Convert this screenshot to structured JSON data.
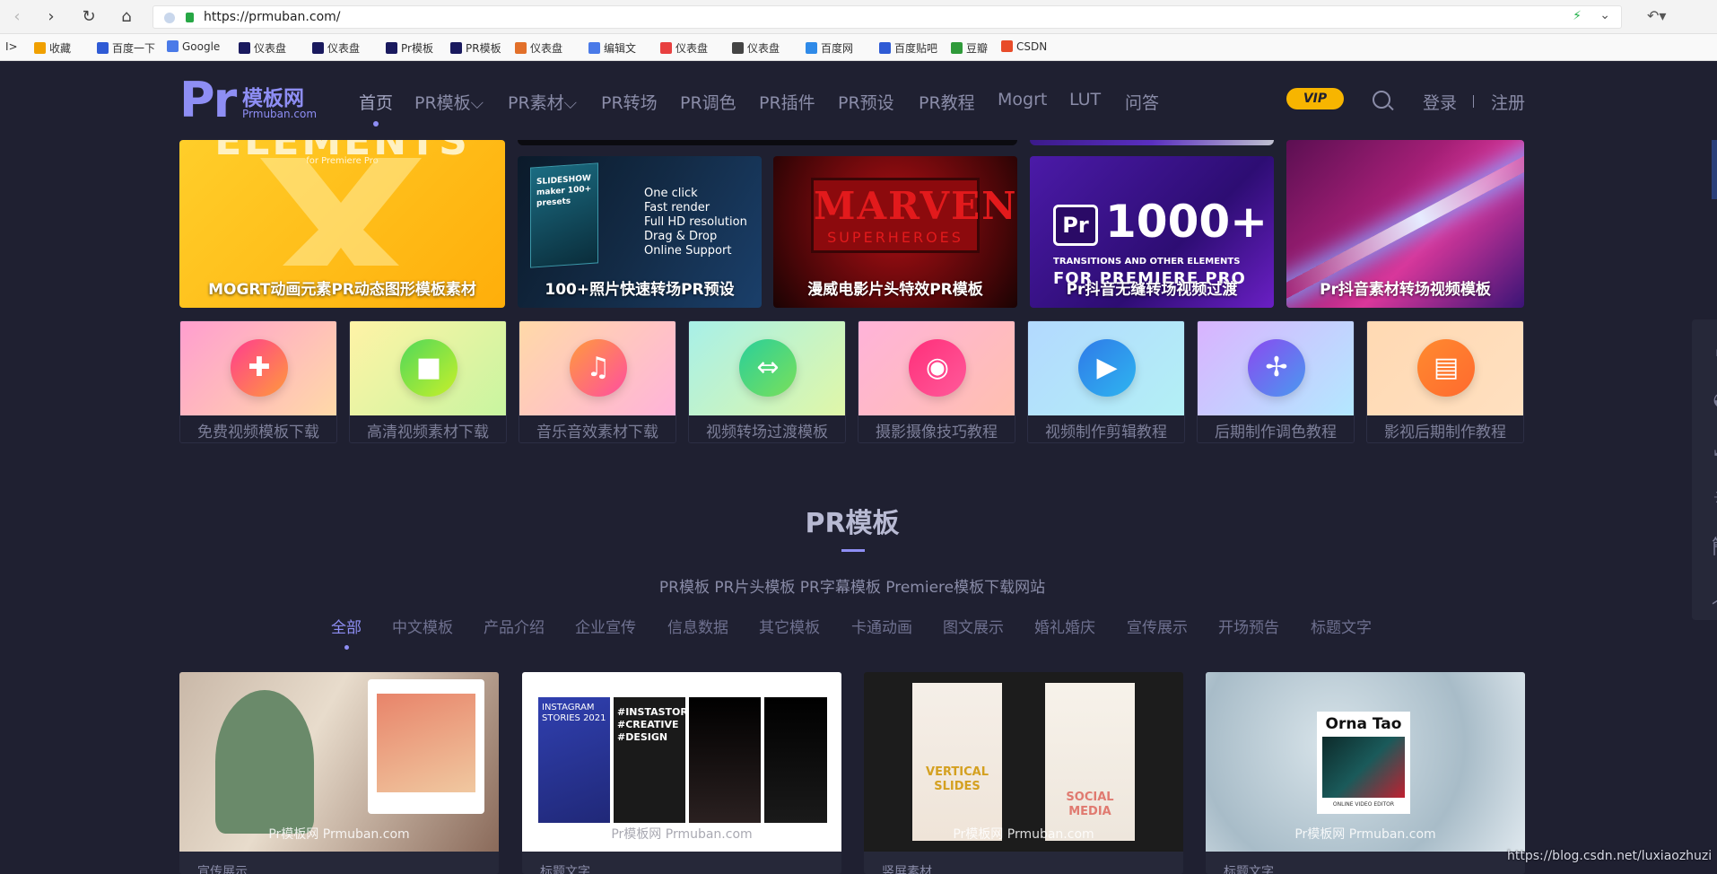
{
  "browser": {
    "url": "https://prmuban.com/",
    "bookmarks_toggle": "I>",
    "bookmarks": [
      {
        "label": "收藏",
        "icon": "star-icon",
        "color": "#f0a000"
      },
      {
        "label": "百度一下",
        "icon": "baidu-icon",
        "color": "#2f5bd5"
      },
      {
        "label": "Google",
        "icon": "google-icon",
        "color": "#4a7ae8"
      },
      {
        "label": "仪表盘",
        "icon": "pr-icon",
        "color": "#1a1a5e"
      },
      {
        "label": "仪表盘",
        "icon": "ae-icon",
        "color": "#1a1a5e"
      },
      {
        "label": "Pr模板",
        "icon": "pr-icon",
        "color": "#1a1a5e"
      },
      {
        "label": "PR模板",
        "icon": "pr-icon",
        "color": "#1a1a5e"
      },
      {
        "label": "仪表盘",
        "icon": "colorful-icon",
        "color": "#e2702a"
      },
      {
        "label": "编辑文",
        "icon": "edit-icon",
        "color": "#4a7ae8"
      },
      {
        "label": "仪表盘",
        "icon": "pr-red-icon",
        "color": "#e84040"
      },
      {
        "label": "仪表盘",
        "icon": "davinci-icon",
        "color": "#444444"
      },
      {
        "label": "百度网",
        "icon": "baidu-pan-icon",
        "color": "#2f8ae8"
      },
      {
        "label": "百度贴吧",
        "icon": "tieba-icon",
        "color": "#2f5bd5"
      },
      {
        "label": "豆瓣",
        "icon": "douban-icon",
        "color": "#2f9a3a"
      },
      {
        "label": "CSDN",
        "icon": "csdn-icon",
        "color": "#e84c2a"
      }
    ]
  },
  "header": {
    "logo_pr": "Pr",
    "logo_cn": "模板网",
    "logo_en": "Prmuban.com",
    "nav": [
      {
        "label": "首页",
        "active": true
      },
      {
        "label": "PR模板⌵"
      },
      {
        "label": "PR素材⌵"
      },
      {
        "label": "PR转场"
      },
      {
        "label": "PR调色"
      },
      {
        "label": "PR插件"
      },
      {
        "label": "PR预设"
      },
      {
        "label": "PR教程"
      },
      {
        "label": "Mogrt"
      },
      {
        "label": "LUT"
      },
      {
        "label": "问答"
      }
    ],
    "vip": "VIP",
    "login": "登录",
    "register": "注册"
  },
  "banners": [
    {
      "caption": "MOGRT动画元素PR动态图形模板素材",
      "top_text": "ELEMENTS",
      "sub_text": "for Premiere Pro"
    },
    {
      "caption": "100+照片快速转场PR预设",
      "box_text": "SLIDESHOW maker 100+ presets",
      "list": "One click\nFast render\nFull HD resolution\nDrag & Drop\nOnline Support"
    },
    {
      "caption": "漫威电影片头特效PR模板",
      "title": "MARVEN",
      "subtitle": "SUPERHEROES"
    },
    {
      "caption": "Pr抖音无缝转场视频过渡",
      "badge": "Pr",
      "number": "1000+",
      "line1": "TRANSITIONS AND OTHER ELEMENTS",
      "line2": "FOR PREMIERE PRO"
    },
    {
      "caption": "Pr抖音素材转场视频模板"
    }
  ],
  "categories": [
    {
      "label": "免费视频模板下载",
      "icon": "puzzle-icon",
      "glyph": "✚",
      "bg": "linear-gradient(135deg,#ff9ecf,#ffd9a8)",
      "circle": "linear-gradient(135deg,#ff3d8e,#ff9a3d)"
    },
    {
      "label": "高清视频素材下载",
      "icon": "video-camera-icon",
      "glyph": "■",
      "bg": "linear-gradient(135deg,#fff3a6,#c8f5a0)",
      "circle": "linear-gradient(135deg,#4fd85a,#c8f02a)"
    },
    {
      "label": "音乐音效素材下载",
      "icon": "music-note-icon",
      "glyph": "♫",
      "bg": "linear-gradient(135deg,#ffd9a8,#ffb3d9)",
      "circle": "linear-gradient(135deg,#ff9a3d,#ff4fa0)"
    },
    {
      "label": "视频转场过渡模板",
      "icon": "transition-icon",
      "glyph": "⇔",
      "bg": "linear-gradient(135deg,#a8f0e8,#e0f7a8)",
      "circle": "linear-gradient(135deg,#2acf9a,#7ae05a)"
    },
    {
      "label": "摄影摄像技巧教程",
      "icon": "camera-icon",
      "glyph": "◉",
      "bg": "linear-gradient(135deg,#ffb3d9,#ffc0b0)",
      "circle": "linear-gradient(135deg,#ff2f7a,#ff5a9a)"
    },
    {
      "label": "视频制作剪辑教程",
      "icon": "film-icon",
      "glyph": "▶",
      "bg": "linear-gradient(135deg,#b3d9ff,#b3f0f5)",
      "circle": "linear-gradient(135deg,#2f7ae8,#2fb5f0)"
    },
    {
      "label": "后期制作调色教程",
      "icon": "aperture-icon",
      "glyph": "✢",
      "bg": "linear-gradient(135deg,#d9b3ff,#b3e8ff)",
      "circle": "linear-gradient(135deg,#8a4af0,#4a9af0)"
    },
    {
      "label": "影视后期制作教程",
      "icon": "news-icon",
      "glyph": "▤",
      "bg": "linear-gradient(135deg,#ffd9b3,#ffe0c0)",
      "circle": "linear-gradient(135deg,#ff8a2f,#ff6a2f)"
    }
  ],
  "section": {
    "title": "PR模板",
    "subtitle": "PR模板 PR片头模板 PR字幕模板 Premiere模板下载网站",
    "filters": [
      {
        "label": "全部",
        "active": true
      },
      {
        "label": "中文模板"
      },
      {
        "label": "产品介绍"
      },
      {
        "label": "企业宣传"
      },
      {
        "label": "信息数据"
      },
      {
        "label": "其它模板"
      },
      {
        "label": "卡通动画"
      },
      {
        "label": "图文展示"
      },
      {
        "label": "婚礼婚庆"
      },
      {
        "label": "宣传展示"
      },
      {
        "label": "开场预告"
      },
      {
        "label": "标题文字"
      }
    ]
  },
  "cards": [
    {
      "watermark": "Pr模板网 Prmuban.com",
      "title": "宣传展示"
    },
    {
      "watermark": "Pr模板网 Prmuban.com",
      "title": "标题文字",
      "texts": [
        "INSTAGRAM STORIES 2021",
        "#INSTASTORY #CREATIVE #DESIGN"
      ]
    },
    {
      "watermark": "Pr模板网 Prmuban.com",
      "title": "竖屏素材",
      "texts": [
        "VERTICAL SLIDES",
        "SOCIAL MEDIA"
      ]
    },
    {
      "watermark": "Pr模板网 Prmuban.com",
      "title": "标题文字",
      "texts": [
        "Orna Tao",
        "ONLINE VIDEO EDITOR"
      ]
    }
  ],
  "side_tools": [
    {
      "icon": "basket-icon",
      "glyph": "⌂"
    },
    {
      "icon": "qq-icon",
      "glyph": "◒"
    },
    {
      "icon": "fullscreen-icon",
      "glyph": "⤢"
    },
    {
      "icon": "brightness-icon",
      "glyph": "☀"
    },
    {
      "icon": "simplified-chinese-icon",
      "glyph": "簡"
    },
    {
      "icon": "back-to-top-icon",
      "glyph": "︿"
    }
  ],
  "watermark": "https://blog.csdn.net/luxiaozhuzi"
}
